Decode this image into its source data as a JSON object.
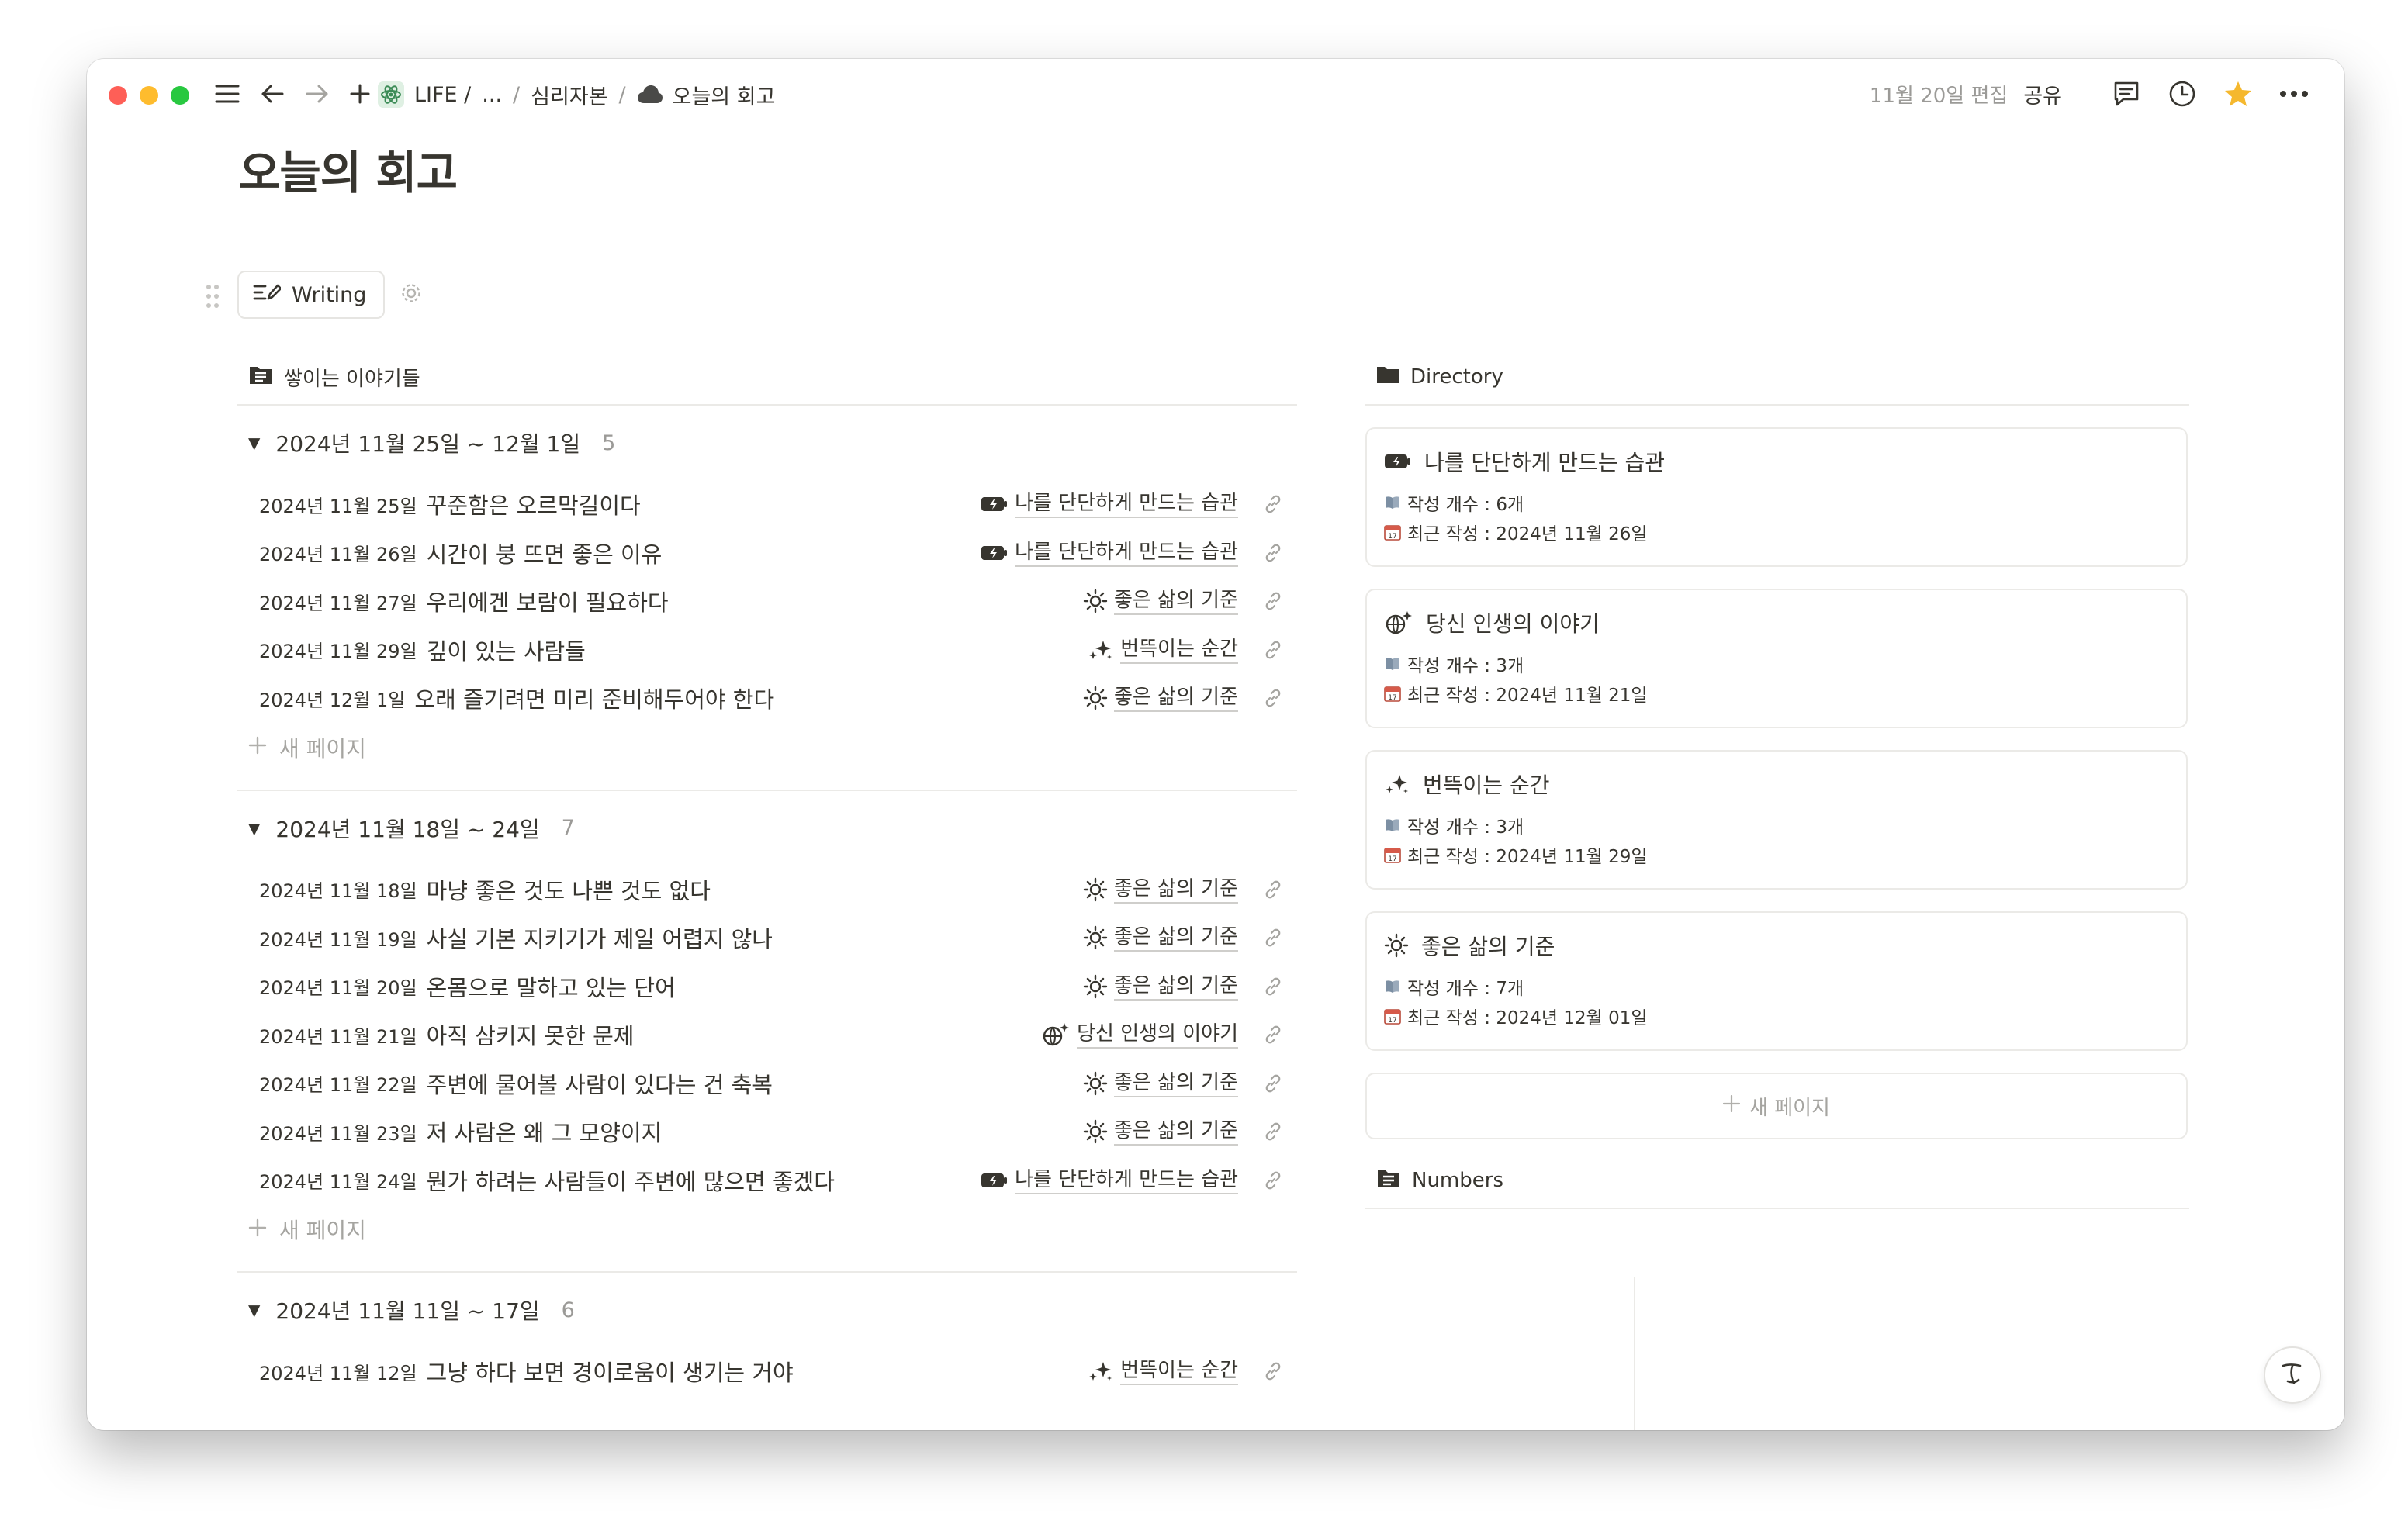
{
  "topbar": {
    "breadcrumbs": {
      "workspace": "LIFE /",
      "ellipsis": "...",
      "parent": "심리자본",
      "current": "오늘의 회고"
    },
    "edited": "11월 20일 편집",
    "share": "공유"
  },
  "page": {
    "title": "오늘의 회고"
  },
  "view_tab": {
    "label": "Writing"
  },
  "left": {
    "header": "쌓이는 이야기들",
    "new_page": "새 페이지",
    "groups": [
      {
        "title": "2024년 11월 25일 ~ 12월 1일",
        "count": "5",
        "rows": [
          {
            "date": "2024년 11월 25일",
            "title": "꾸준함은 오르막길이다",
            "tag": "나를 단단하게 만드는 습관",
            "icon": "battery-icon"
          },
          {
            "date": "2024년 11월 26일",
            "title": "시간이 붕 뜨면 좋은 이유",
            "tag": "나를 단단하게 만드는 습관",
            "icon": "battery-icon"
          },
          {
            "date": "2024년 11월 27일",
            "title": "우리에겐 보람이 필요하다",
            "tag": "좋은 삶의 기준",
            "icon": "sun-icon"
          },
          {
            "date": "2024년 11월 29일",
            "title": "깊이 있는 사람들",
            "tag": "번뜩이는 순간",
            "icon": "sparkles-icon"
          },
          {
            "date": "2024년 12월 1일",
            "title": "오래 즐기려면 미리 준비해두어야 한다",
            "tag": "좋은 삶의 기준",
            "icon": "sun-icon"
          }
        ]
      },
      {
        "title": "2024년 11월 18일 ~ 24일",
        "count": "7",
        "rows": [
          {
            "date": "2024년 11월 18일",
            "title": "마냥 좋은 것도 나쁜 것도 없다",
            "tag": "좋은 삶의 기준",
            "icon": "sun-icon"
          },
          {
            "date": "2024년 11월 19일",
            "title": "사실 기본 지키기가 제일 어렵지 않나",
            "tag": "좋은 삶의 기준",
            "icon": "sun-icon"
          },
          {
            "date": "2024년 11월 20일",
            "title": "온몸으로 말하고 있는 단어",
            "tag": "좋은 삶의 기준",
            "icon": "sun-icon"
          },
          {
            "date": "2024년 11월 21일",
            "title": "아직 삼키지 못한 문제",
            "tag": "당신 인생의 이야기",
            "icon": "globe-sparkle-icon"
          },
          {
            "date": "2024년 11월 22일",
            "title": "주변에 물어볼 사람이 있다는 건 축복",
            "tag": "좋은 삶의 기준",
            "icon": "sun-icon"
          },
          {
            "date": "2024년 11월 23일",
            "title": "저 사람은 왜 그 모양이지",
            "tag": "좋은 삶의 기준",
            "icon": "sun-icon"
          },
          {
            "date": "2024년 11월 24일",
            "title": "뭔가 하려는 사람들이 주변에 많으면 좋겠다",
            "tag": "나를 단단하게 만드는 습관",
            "icon": "battery-icon"
          }
        ]
      },
      {
        "title": "2024년 11월 11일 ~ 17일",
        "count": "6",
        "rows": [
          {
            "date": "2024년 11월 12일",
            "title": "그냥 하다 보면 경이로움이 생기는 거야",
            "tag": "번뜩이는 순간",
            "icon": "sparkles-icon"
          }
        ]
      }
    ]
  },
  "right": {
    "header": "Directory",
    "cards": [
      {
        "title": "나를 단단하게 만드는 습관",
        "icon": "battery-icon",
        "count": "작성 개수 : 6개",
        "recent": "최근 작성 : 2024년 11월 26일"
      },
      {
        "title": "당신 인생의 이야기",
        "icon": "globe-sparkle-icon",
        "count": "작성 개수 : 3개",
        "recent": "최근 작성 : 2024년 11월 21일"
      },
      {
        "title": "번뜩이는 순간",
        "icon": "sparkles-icon",
        "count": "작성 개수 : 3개",
        "recent": "최근 작성 : 2024년 11월 29일"
      },
      {
        "title": "좋은 삶의 기준",
        "icon": "sun-icon",
        "count": "작성 개수 : 7개",
        "recent": "최근 작성 : 2024년 12월 01일"
      }
    ],
    "new_page": "새 페이지",
    "numbers_header": "Numbers"
  },
  "colors": {
    "text": "#37352f",
    "muted": "#9b9a97",
    "border": "#ebeae7",
    "star": "#f5b82e"
  }
}
